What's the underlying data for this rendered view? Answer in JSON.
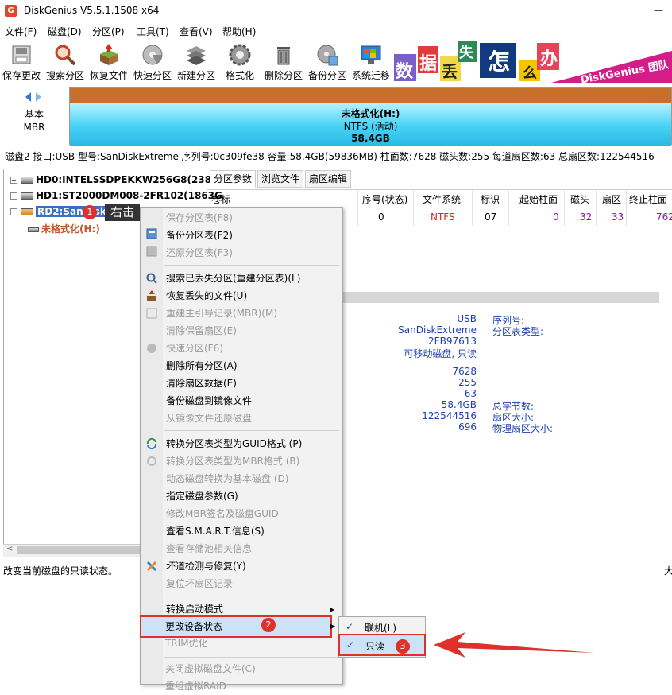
{
  "window": {
    "title": "DiskGenius V5.5.1.1508 x64",
    "app_icon": "G",
    "minimize": "—"
  },
  "menu": [
    "文件(F)",
    "磁盘(D)",
    "分区(P)",
    "工具(T)",
    "查看(V)",
    "帮助(H)"
  ],
  "toolbar": [
    "保存更改",
    "搜索分区",
    "恢复文件",
    "快速分区",
    "新建分区",
    "格式化",
    "删除分区",
    "备份分区",
    "系统迁移"
  ],
  "banner": {
    "chars": [
      "数",
      "据",
      "丢",
      "失",
      "怎",
      "么",
      "办"
    ],
    "tagline": "DiskGenius 团队"
  },
  "disk": {
    "kind": "基本",
    "ptype": "MBR"
  },
  "partition_bar": {
    "name": "未格式化(H:)",
    "fs": "NTFS (活动)",
    "size": "58.4GB"
  },
  "disk_info": "磁盘2 接口:USB  型号:SanDiskExtreme  序列号:0c309fe38  容量:58.4GB(59836MB)  柱面数:7628  磁头数:255  每道扇区数:63  总扇区数:122544516",
  "tree": {
    "items": [
      "HD0:INTELSSDPEKKW256G8(238G",
      "HD1:ST2000DM008-2FR102(1863G",
      "RD2:SanDisk",
      "未格式化(H:)"
    ]
  },
  "tabs": [
    "分区参数",
    "浏览文件",
    "扇区编辑"
  ],
  "table": {
    "headers": [
      "卷标",
      "序号(状态)",
      "文件系统",
      "标识",
      "起始柱面",
      "磁头",
      "扇区",
      "终止柱面"
    ],
    "row": {
      "seq": "0",
      "fs": "NTFS",
      "id": "07",
      "start_cyl": "0",
      "head": "32",
      "sector": "33",
      "end_cyl": "762"
    }
  },
  "info_values": [
    "USB",
    "SanDiskExtreme",
    "2FB97613",
    "可移动磁盘, 只读",
    "7628",
    "255",
    "63",
    "58.4GB",
    "122544516",
    "696"
  ],
  "info_keys": [
    "序列号:",
    "分区表类型:",
    "总字节数:",
    "扇区大小:",
    "物理扇区大小:"
  ],
  "status": {
    "text": "改变当前磁盘的只读状态。",
    "right": "大"
  },
  "context_menu": {
    "items": [
      {
        "label": "保存分区表(F8)",
        "disabled": true
      },
      {
        "label": "备份分区表(F2)",
        "disabled": false
      },
      {
        "label": "还原分区表(F3)",
        "disabled": true
      },
      {
        "label": "搜索已丢失分区(重建分区表)(L)",
        "disabled": false
      },
      {
        "label": "恢复丢失的文件(U)",
        "disabled": false
      },
      {
        "label": "重建主引导记录(MBR)(M)",
        "disabled": true
      },
      {
        "label": "清除保留扇区(E)",
        "disabled": true
      },
      {
        "label": "快速分区(F6)",
        "disabled": true
      },
      {
        "label": "删除所有分区(A)",
        "disabled": false
      },
      {
        "label": "清除扇区数据(E)",
        "disabled": false
      },
      {
        "label": "备份磁盘到镜像文件",
        "disabled": false
      },
      {
        "label": "从镜像文件还原磁盘",
        "disabled": true
      },
      {
        "label": "转换分区表类型为GUID格式 (P)",
        "disabled": false
      },
      {
        "label": "转换分区表类型为MBR格式 (B)",
        "disabled": true
      },
      {
        "label": "动态磁盘转换为基本磁盘 (D)",
        "disabled": true
      },
      {
        "label": "指定磁盘参数(G)",
        "disabled": false
      },
      {
        "label": "修改MBR签名及磁盘GUID",
        "disabled": true
      },
      {
        "label": "查看S.M.A.R.T.信息(S)",
        "disabled": false
      },
      {
        "label": "查看存储池相关信息",
        "disabled": true
      },
      {
        "label": "坏道检测与修复(Y)",
        "disabled": false
      },
      {
        "label": "复位坏扇区记录",
        "disabled": true
      },
      {
        "label": "转换启动模式",
        "disabled": false
      },
      {
        "label": "更改设备状态",
        "disabled": false
      },
      {
        "label": "TRIM优化",
        "disabled": true
      },
      {
        "label": "关闭虚拟磁盘文件(C)",
        "disabled": true
      },
      {
        "label": "重组虚拟RAID",
        "disabled": true
      }
    ],
    "submenu_arrow": "▶"
  },
  "submenu": {
    "items": [
      "联机(L)",
      "只读"
    ],
    "check": "✓"
  },
  "annotations": {
    "badges": [
      "1",
      "2",
      "3"
    ],
    "tooltip": "右击"
  },
  "colors": {
    "accent": "#e0302a",
    "highlight": "#cce2f7",
    "info_blue": "#1e3fb0",
    "ntfs_red": "#d0261e",
    "purple": "#8b1aa3"
  }
}
